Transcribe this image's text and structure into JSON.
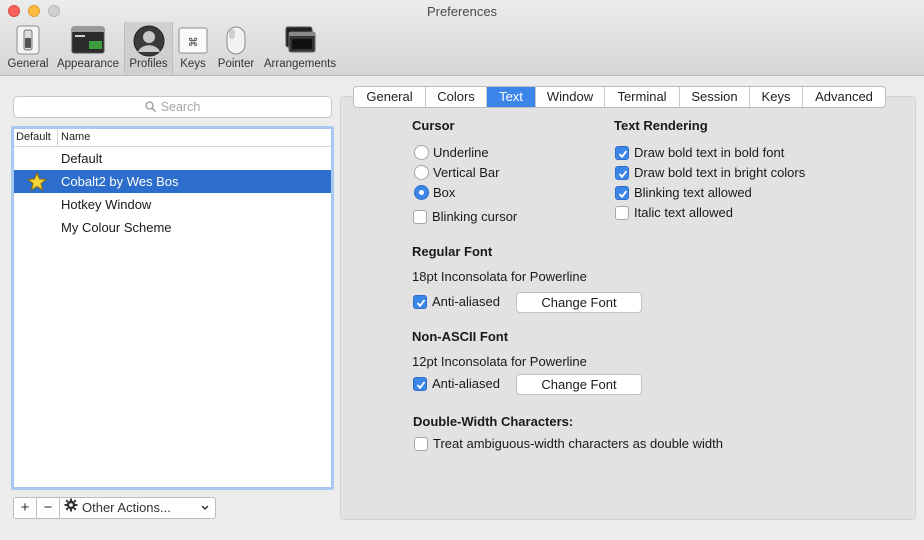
{
  "window": {
    "title": "Preferences"
  },
  "toolbar": {
    "items": [
      {
        "label": "General",
        "icon": "switch-icon"
      },
      {
        "label": "Appearance",
        "icon": "appearance-icon"
      },
      {
        "label": "Profiles",
        "icon": "profile-user-icon",
        "selected": true
      },
      {
        "label": "Keys",
        "icon": "keyboard-command-icon"
      },
      {
        "label": "Pointer",
        "icon": "mouse-icon"
      },
      {
        "label": "Arrangements",
        "icon": "windows-stack-icon"
      }
    ]
  },
  "profiles": {
    "search_placeholder": "Search",
    "columns": {
      "default": "Default",
      "name": "Name"
    },
    "items": [
      {
        "name": "Default",
        "is_default": false,
        "selected": false
      },
      {
        "name": "Cobalt2 by Wes Bos",
        "is_default": true,
        "selected": true
      },
      {
        "name": "Hotkey Window",
        "is_default": false,
        "selected": false
      },
      {
        "name": "My Colour Scheme",
        "is_default": false,
        "selected": false
      }
    ],
    "buttons": {
      "add": "+",
      "remove": "−",
      "other_actions": "Other Actions..."
    }
  },
  "tabs": {
    "items": [
      "General",
      "Colors",
      "Text",
      "Window",
      "Terminal",
      "Session",
      "Keys",
      "Advanced"
    ],
    "active": "Text"
  },
  "text_tab": {
    "cursor": {
      "heading": "Cursor",
      "options": [
        {
          "label": "Underline",
          "checked": false
        },
        {
          "label": "Vertical Bar",
          "checked": false
        },
        {
          "label": "Box",
          "checked": true
        }
      ],
      "blinking": {
        "label": "Blinking cursor",
        "checked": false
      }
    },
    "rendering": {
      "heading": "Text Rendering",
      "options": [
        {
          "label": "Draw bold text in bold font",
          "checked": true
        },
        {
          "label": "Draw bold text in bright colors",
          "checked": true
        },
        {
          "label": "Blinking text allowed",
          "checked": true
        },
        {
          "label": "Italic text allowed",
          "checked": false
        }
      ]
    },
    "regular_font": {
      "heading": "Regular Font",
      "font": "18pt Inconsolata for Powerline",
      "anti_aliased": {
        "label": "Anti-aliased",
        "checked": true
      },
      "change_button": "Change Font"
    },
    "non_ascii_font": {
      "heading": "Non-ASCII Font",
      "font": "12pt Inconsolata for Powerline",
      "anti_aliased": {
        "label": "Anti-aliased",
        "checked": true
      },
      "change_button": "Change Font"
    },
    "double_width": {
      "heading": "Double-Width Characters:",
      "option": {
        "label": "Treat ambiguous-width characters as double width",
        "checked": false
      }
    }
  },
  "colors": {
    "accent": "#3c86e9",
    "selection": "#2d6dcc",
    "focus_ring": "#a8c9ef"
  }
}
